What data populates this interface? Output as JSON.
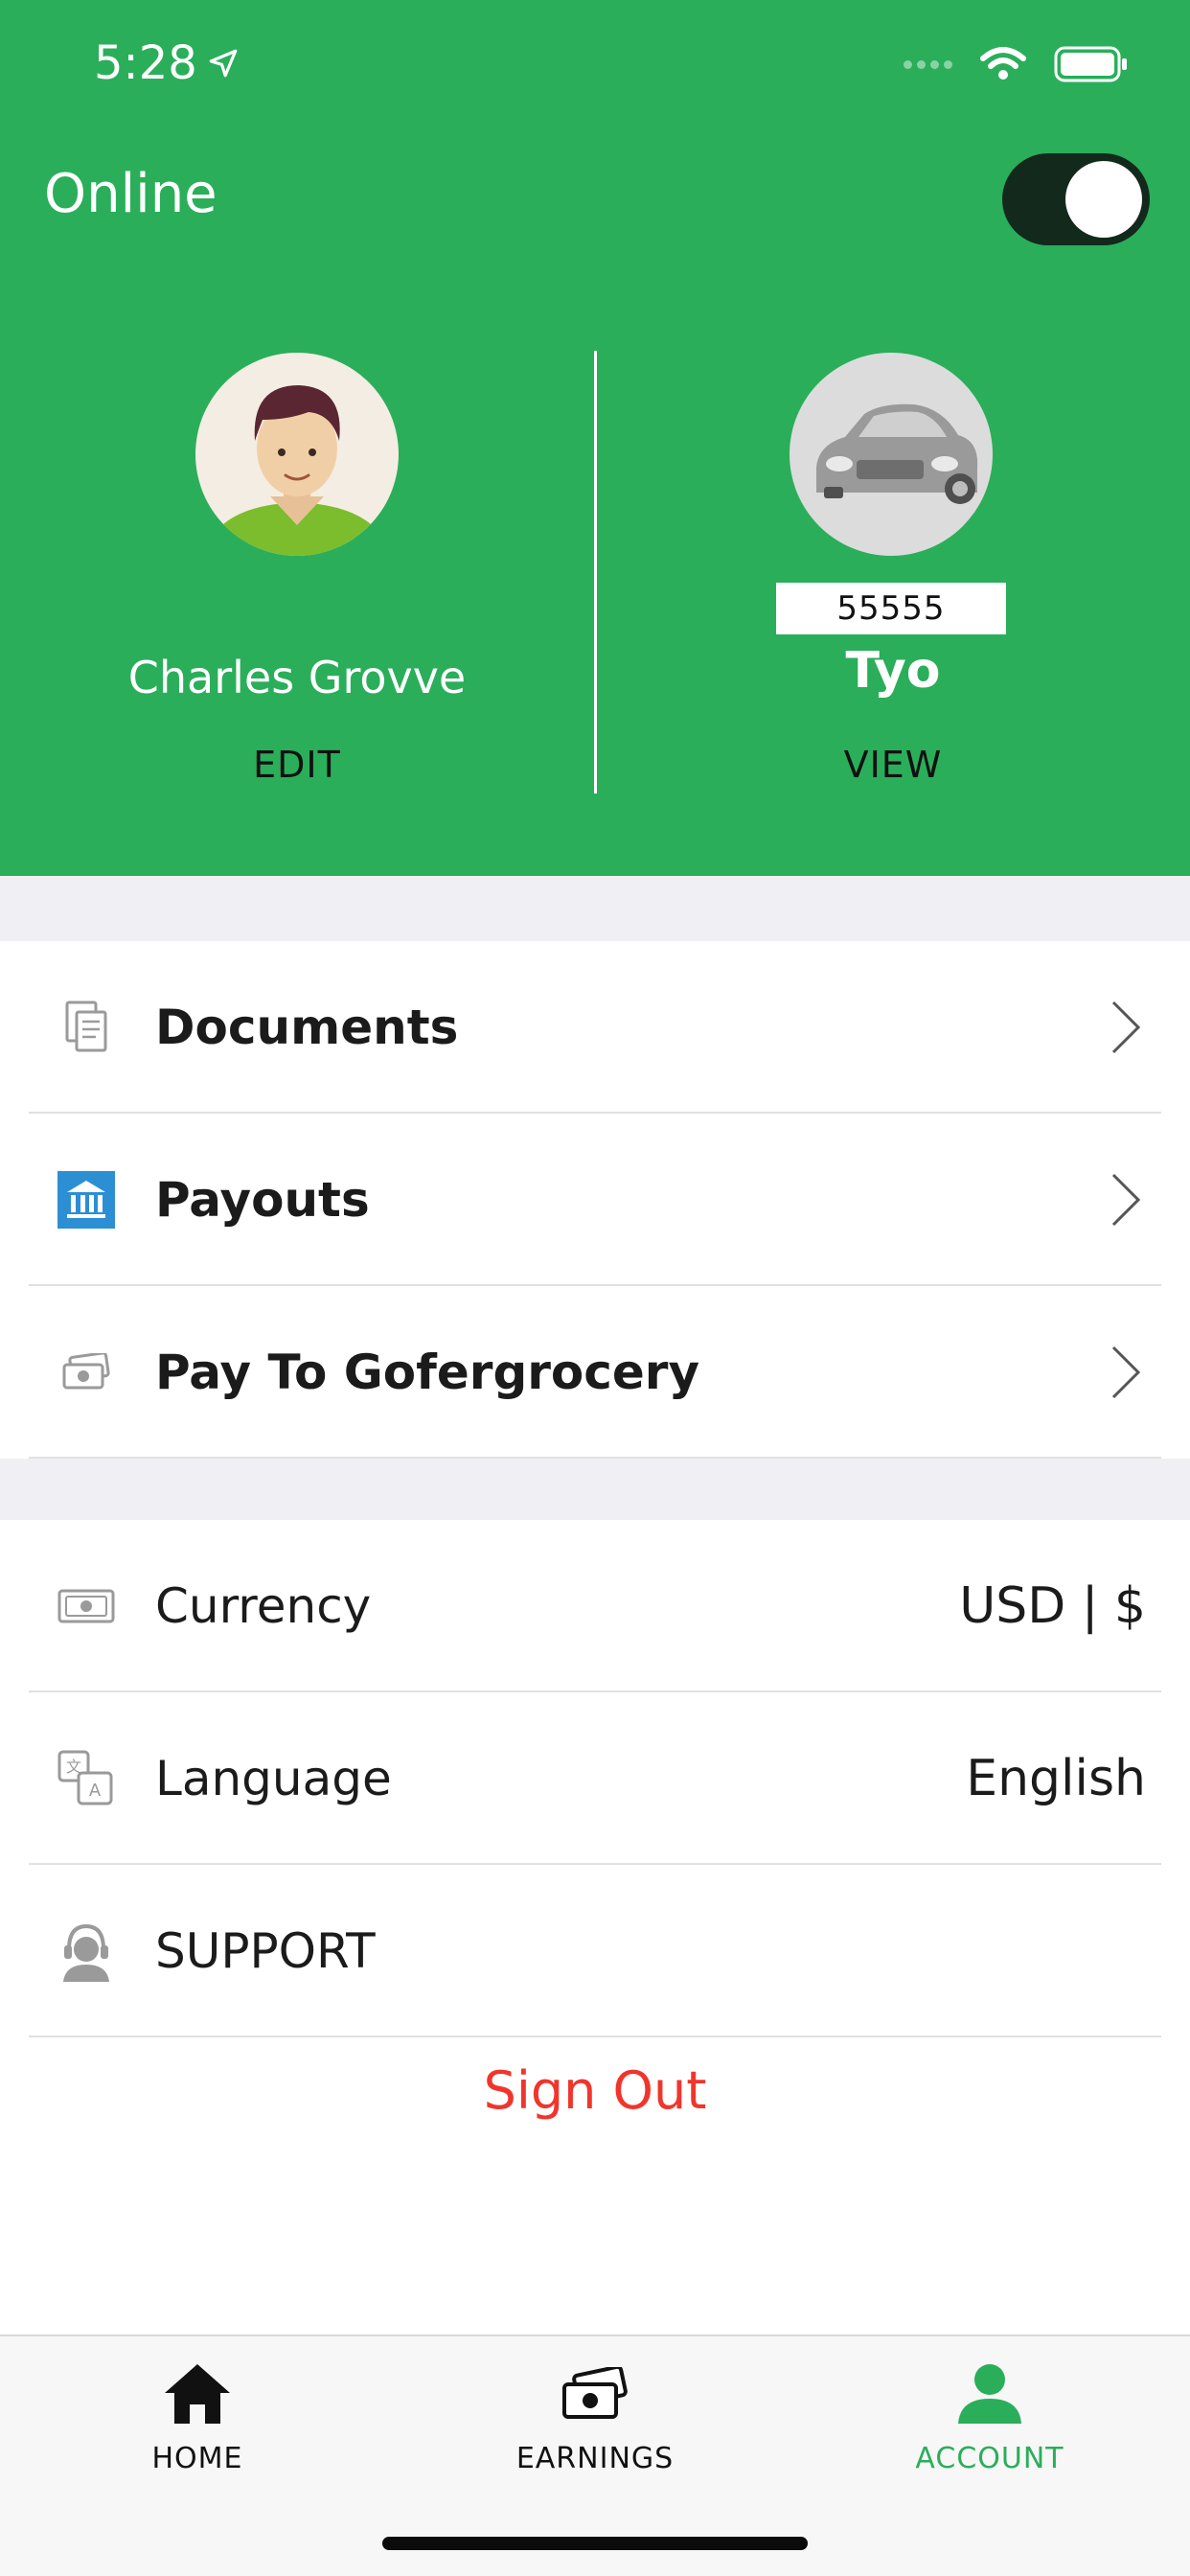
{
  "status_bar": {
    "time": "5:28"
  },
  "header": {
    "status_label": "Online",
    "online": true,
    "driver": {
      "name": "Charles Grovve",
      "edit_label": "EDIT"
    },
    "vehicle": {
      "plate": "55555",
      "name": "Tyo",
      "view_label": "VIEW"
    }
  },
  "menu_primary": [
    {
      "label": "Documents",
      "icon": "documents-icon"
    },
    {
      "label": "Payouts",
      "icon": "bank-icon"
    },
    {
      "label": "Pay To  Gofergrocery",
      "icon": "cash-icon"
    }
  ],
  "menu_settings": [
    {
      "label": "Currency",
      "value": "USD | $",
      "icon": "currency-icon"
    },
    {
      "label": "Language",
      "value": "English",
      "icon": "language-icon"
    },
    {
      "label": "SUPPORT",
      "icon": "support-icon"
    }
  ],
  "sign_out_label": "Sign Out",
  "tabs": [
    {
      "label": "HOME",
      "icon": "home-icon",
      "active": false
    },
    {
      "label": "EARNINGS",
      "icon": "earnings-icon",
      "active": false
    },
    {
      "label": "ACCOUNT",
      "icon": "account-icon",
      "active": true
    }
  ],
  "colors": {
    "brand": "#2aae5a",
    "sign_out": "#f0352c",
    "toggle_track": "#13291c"
  }
}
